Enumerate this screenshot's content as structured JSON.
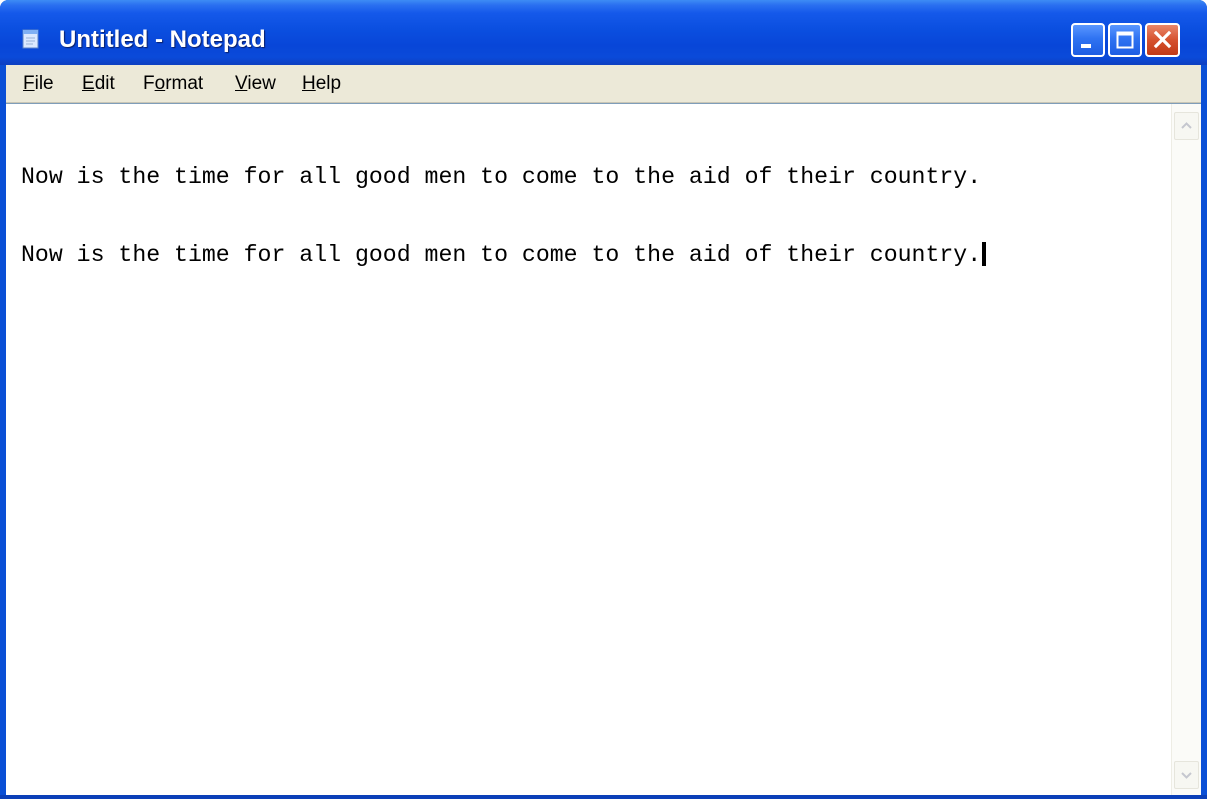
{
  "window": {
    "title": "Untitled - Notepad",
    "app_icon": "notepad-icon",
    "controls": {
      "minimize_icon": "minimize-icon",
      "maximize_icon": "maximize-icon",
      "close_icon": "close-icon"
    }
  },
  "menubar": {
    "items": [
      {
        "label": "File",
        "mnemonic": "F"
      },
      {
        "label": "Edit",
        "mnemonic": "E"
      },
      {
        "label": "Format",
        "mnemonic": "o"
      },
      {
        "label": "View",
        "mnemonic": "V"
      },
      {
        "label": "Help",
        "mnemonic": "H"
      }
    ]
  },
  "editor": {
    "lines": [
      "Now is the time for all good men to come to the aid of their country.",
      "Now is the time for all good men to come to the aid of their country."
    ]
  },
  "scrollbar": {
    "up_icon": "scroll-up-arrow-icon",
    "down_icon": "scroll-down-arrow-icon"
  },
  "colors": {
    "titlebar": "#0a4fd6",
    "menubar_bg": "#ece9d8",
    "close_button": "#d6522e",
    "editor_bg": "#ffffff"
  }
}
